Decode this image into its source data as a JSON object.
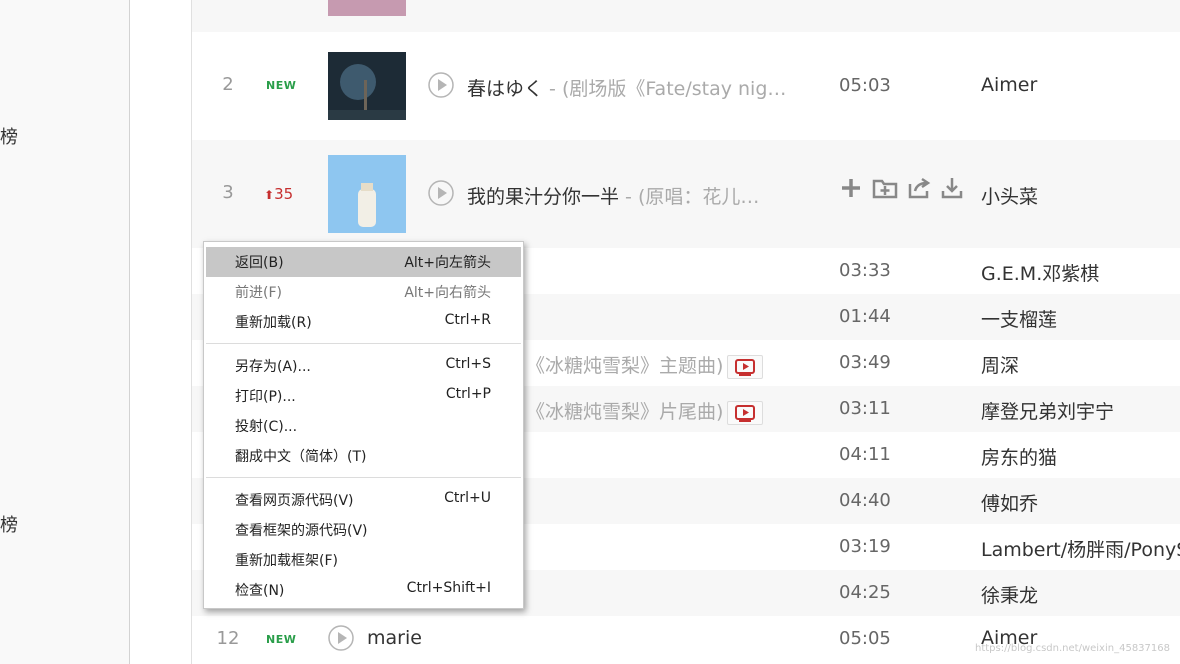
{
  "sidebar": {
    "label_a": "榜",
    "label_b": "榜"
  },
  "songs": [
    {
      "rank": "2",
      "badge": "NEW",
      "title": "春はゆく",
      "subtitle": " - (剧场版《Fate/stay nig…",
      "duration": "05:03",
      "artist": "Aimer"
    },
    {
      "rank": "3",
      "badge": "35",
      "title": "我的果汁分你一半",
      "subtitle": " - (原唱：花儿…",
      "artist": "小头菜"
    },
    {
      "duration": "03:33",
      "artist": "G.E.M.邓紫棋"
    },
    {
      "duration": "01:44",
      "artist": "一支榴莲"
    },
    {
      "title_tail": "《冰糖炖雪梨》主题曲)",
      "duration": "03:49",
      "artist": "周深"
    },
    {
      "title_tail": "《冰糖炖雪梨》片尾曲)",
      "duration": "03:11",
      "artist": "摩登兄弟刘宇宁"
    },
    {
      "duration": "04:11",
      "artist": "房东的猫"
    },
    {
      "duration": "04:40",
      "artist": "傅如乔"
    },
    {
      "duration": "03:19",
      "artist": "Lambert/杨胖雨/PonySo"
    },
    {
      "duration": "04:25",
      "artist": "徐秉龙"
    },
    {
      "rank": "12",
      "badge": "NEW",
      "title": "marie",
      "duration": "05:05",
      "artist": "Aimer"
    }
  ],
  "context_menu": {
    "items": [
      {
        "label": "返回(B)",
        "shortcut": "Alt+向左箭头"
      },
      {
        "label": "前进(F)",
        "shortcut": "Alt+向右箭头"
      },
      {
        "label": "重新加载(R)",
        "shortcut": "Ctrl+R"
      },
      {
        "label": "另存为(A)...",
        "shortcut": "Ctrl+S"
      },
      {
        "label": "打印(P)...",
        "shortcut": "Ctrl+P"
      },
      {
        "label": "投射(C)...",
        "shortcut": ""
      },
      {
        "label": "翻成中文（简体）(T)",
        "shortcut": ""
      },
      {
        "label": "查看网页源代码(V)",
        "shortcut": "Ctrl+U"
      },
      {
        "label": "查看框架的源代码(V)",
        "shortcut": ""
      },
      {
        "label": "重新加载框架(F)",
        "shortcut": ""
      },
      {
        "label": "检查(N)",
        "shortcut": "Ctrl+Shift+I"
      }
    ]
  },
  "watermark": "https://blog.csdn.net/weixin_45837168",
  "colors": {
    "new_badge": "#2a9e4a",
    "up_badge": "#c62f2f",
    "mv_red": "#c62f2f",
    "menu_highlight": "#c7c7c7"
  },
  "icons": [
    "play-icon",
    "add-icon",
    "add-to-folder-icon",
    "share-icon",
    "download-icon",
    "mv-icon",
    "arrow-up-icon"
  ]
}
